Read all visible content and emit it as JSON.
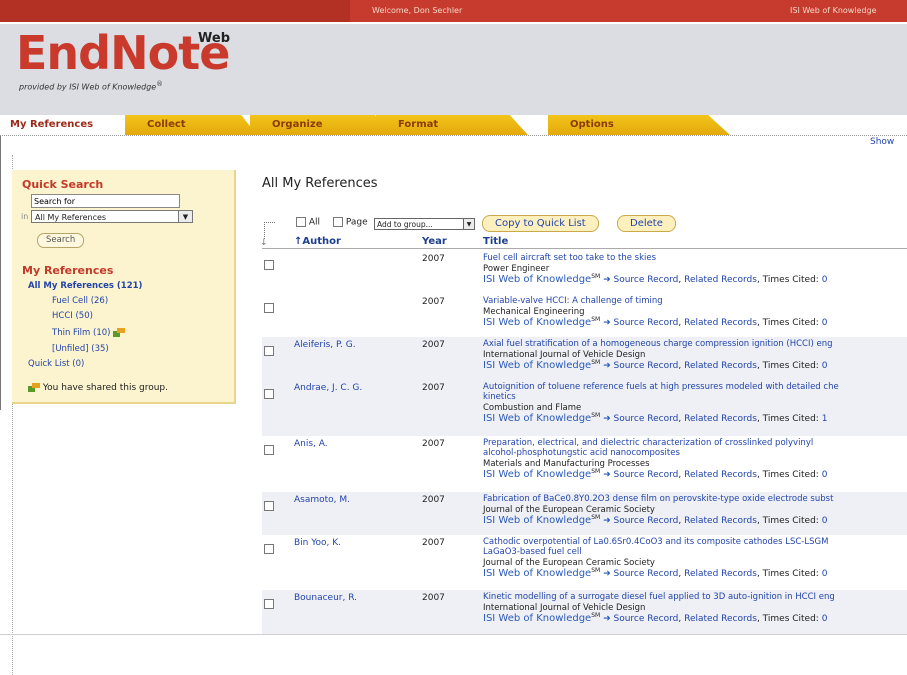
{
  "topbar": {
    "welcome": "Welcome, Don Sechler",
    "site": "ISI Web of Knowledge"
  },
  "header": {
    "logo": "EndNote",
    "logo_sup": "Web",
    "tagline": "provided by ISI Web of Knowledge",
    "registered": "®"
  },
  "tabs": [
    {
      "label": "My References"
    },
    {
      "label": "Collect"
    },
    {
      "label": "Organize"
    },
    {
      "label": "Format"
    },
    {
      "label": "Options"
    }
  ],
  "show_link": "Show",
  "sidebar": {
    "quick_search_title": "Quick Search",
    "search_value": "Search for",
    "in_label": "in",
    "in_select": "All My References",
    "search_button": "Search",
    "my_refs_title": "My References",
    "items": [
      {
        "label": "All My References (121)"
      },
      {
        "label": "Fuel Cell (26)"
      },
      {
        "label": "HCCI (50)"
      },
      {
        "label": "Thin Film (10)"
      },
      {
        "label": "[Unfiled] (35)"
      },
      {
        "label": "Quick List (0)"
      }
    ],
    "shared_note": "You have shared this group."
  },
  "main": {
    "title": "All My References",
    "select_all": "All",
    "select_page": "Page",
    "add_to_group": "Add to group...",
    "copy_button": "Copy to Quick List",
    "delete_button": "Delete",
    "columns": {
      "author": "Author",
      "year": "Year",
      "title": "Title"
    },
    "wok": {
      "isi": "ISI Web of Knowledge",
      "sm": "SM",
      "arrow": "➜",
      "source": "Source Record",
      "related": "Related Records",
      "cited_label": "Times Cited:"
    },
    "rows": [
      {
        "author": "",
        "year": "2007",
        "title": "Fuel cell aircraft set too take to the skies",
        "journal": "Power Engineer",
        "cited": "0"
      },
      {
        "author": "",
        "year": "2007",
        "title": "Variable-valve HCCI: A challenge of timing",
        "journal": "Mechanical Engineering",
        "cited": "0"
      },
      {
        "author": "Aleiferis, P. G.",
        "year": "2007",
        "title": "Axial fuel stratification of a homogeneous charge compression ignition (HCCI) eng",
        "journal": "International Journal of Vehicle Design",
        "cited": "0"
      },
      {
        "author": "Andrae, J. C. G.",
        "year": "2007",
        "title": "Autoignition of toluene reference fuels at high pressures modeled with detailed che\nkinetics",
        "journal": "Combustion and Flame",
        "cited": "1"
      },
      {
        "author": "Anis, A.",
        "year": "2007",
        "title": "Preparation, electrical, and dielectric characterization of crosslinked polyvinyl\nalcohol-phosphotungstic acid nanocomposites",
        "journal": "Materials and Manufacturing Processes",
        "cited": "0"
      },
      {
        "author": "Asamoto, M.",
        "year": "2007",
        "title": "Fabrication of BaCe0.8Y0.2O3 dense film on perovskite-type oxide electrode subst",
        "journal": "Journal of the European Ceramic Society",
        "cited": "0"
      },
      {
        "author": "Bin Yoo, K.",
        "year": "2007",
        "title": "Cathodic overpotential of La0.6Sr0.4CoO3 and its composite cathodes LSC-LSGM\nLaGaO3-based fuel cell",
        "journal": "Journal of the European Ceramic Society",
        "cited": "0"
      },
      {
        "author": "Bounaceur, R.",
        "year": "2007",
        "title": "Kinetic modelling of a surrogate diesel fuel applied to 3D auto-ignition in HCCI eng",
        "journal": "International Journal of Vehicle Design",
        "cited": "0"
      }
    ]
  },
  "colors": {
    "brand_red": "#c93a2c",
    "tab_yellow": "#f3c41a",
    "link_blue": "#2244aa"
  }
}
